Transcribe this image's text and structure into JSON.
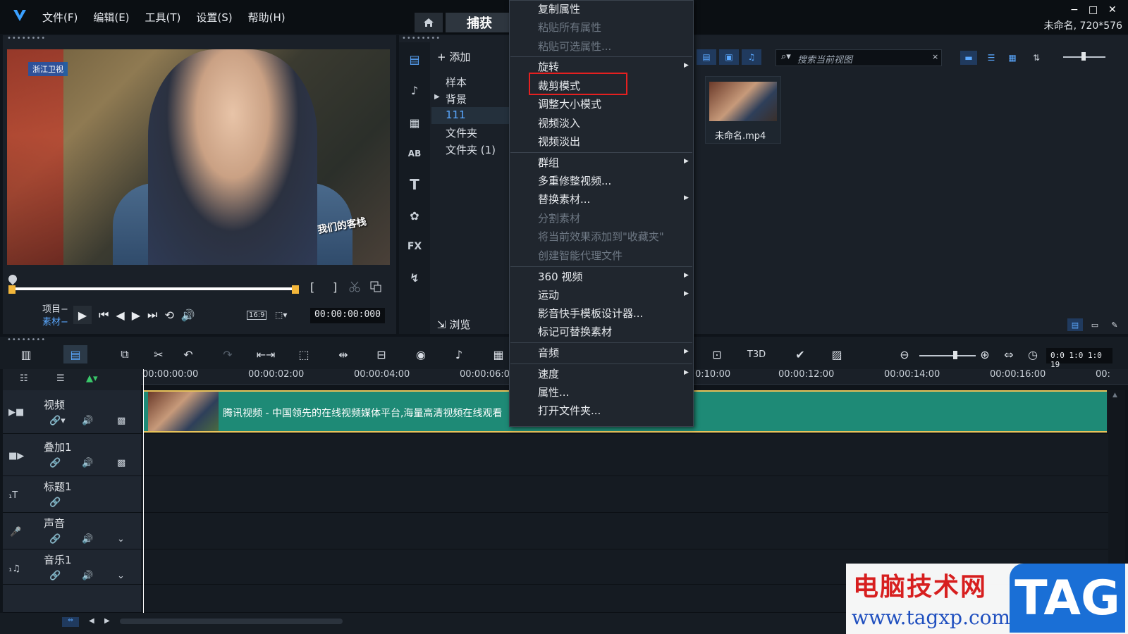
{
  "menubar": [
    "文件(F)",
    "编辑(E)",
    "工具(T)",
    "设置(S)",
    "帮助(H)"
  ],
  "tabs": {
    "capture": "捕获"
  },
  "window_controls": {
    "minimize": "−",
    "maximize": "□",
    "close": "✕"
  },
  "project_info": "未命名, 720*576",
  "preview": {
    "channel_logo": "浙江卫视",
    "show_watermark": "我们的客栈",
    "mark_in": "[",
    "mark_out": "]",
    "mode_project": "项目",
    "mode_clip": "素材",
    "ratio": "16:9",
    "timecode": "00:00:00:000"
  },
  "library": {
    "add_label": "添加",
    "folders": [
      "样本",
      "背景",
      "111",
      "文件夹",
      "文件夹 (1)"
    ],
    "active_folder": "111",
    "search_placeholder": "搜索当前视图",
    "browse_label": "浏览",
    "thumb_label": "未命名.mp4"
  },
  "context_menu": {
    "items": [
      {
        "label": "复制属性",
        "disabled": false
      },
      {
        "label": "粘贴所有属性",
        "disabled": true
      },
      {
        "label": "粘贴可选属性...",
        "disabled": true
      },
      {
        "label": "旋转",
        "disabled": false,
        "submenu": true
      },
      {
        "label": "裁剪模式",
        "disabled": false,
        "highlighted": true
      },
      {
        "label": "调整大小模式",
        "disabled": false
      },
      {
        "label": "视频淡入",
        "disabled": false
      },
      {
        "label": "视频淡出",
        "disabled": false
      },
      {
        "label": "群组",
        "disabled": false,
        "submenu": true
      },
      {
        "label": "多重修整视频...",
        "disabled": false
      },
      {
        "label": "替换素材...",
        "disabled": false,
        "submenu": true
      },
      {
        "label": "分割素材",
        "disabled": true
      },
      {
        "label": "将当前效果添加到\"收藏夹\"",
        "disabled": true
      },
      {
        "label": "创建智能代理文件",
        "disabled": true
      },
      {
        "label": "360 视频",
        "disabled": false,
        "submenu": true
      },
      {
        "label": "运动",
        "disabled": false,
        "submenu": true
      },
      {
        "label": "影音快手模板设计器...",
        "disabled": false
      },
      {
        "label": "标记可替换素材",
        "disabled": false
      },
      {
        "label": "音频",
        "disabled": false,
        "submenu": true
      },
      {
        "label": "速度",
        "disabled": false,
        "submenu": true
      },
      {
        "label": "属性...",
        "disabled": false
      },
      {
        "label": "打开文件夹...",
        "disabled": false
      }
    ]
  },
  "timeline": {
    "ruler": [
      "00:00:00:00",
      "00:00:02:00",
      "00:00:04:00",
      "00:00:06:00",
      "0:10:00",
      "00:00:12:00",
      "00:00:14:00",
      "00:00:16:00",
      "00:"
    ],
    "zoom_timecode": "0:0 1:0 1:0 19",
    "tracks": [
      "视频",
      "叠加1",
      "标题1",
      "声音",
      "音乐1"
    ],
    "clip_title": "腾讯视频 - 中国领先的在线视频媒体平台,海量高清视频在线观看"
  },
  "watermark": {
    "site_name": "电脑技术网",
    "url": "www.tagxp.com",
    "tag": "TAG"
  },
  "colors": {
    "accent": "#5aa8ff",
    "clip": "#1e8a76",
    "highlight_box": "#e52020",
    "mark": "#f3b63a"
  }
}
